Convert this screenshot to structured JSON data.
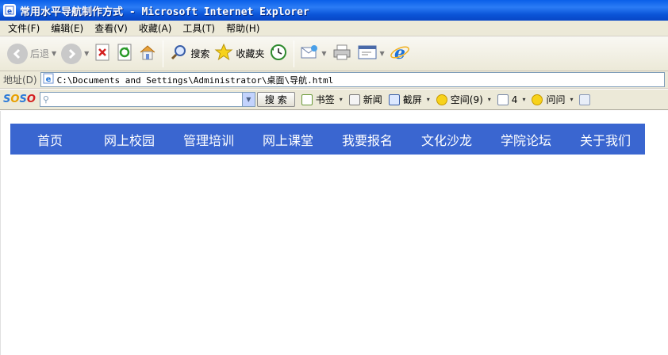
{
  "window": {
    "title": "常用水平导航制作方式 - Microsoft Internet Explorer"
  },
  "menu": [
    {
      "label": "文件(F)"
    },
    {
      "label": "编辑(E)"
    },
    {
      "label": "查看(V)"
    },
    {
      "label": "收藏(A)"
    },
    {
      "label": "工具(T)"
    },
    {
      "label": "帮助(H)"
    }
  ],
  "toolbar": {
    "back_label": "后退",
    "search_label": "搜索",
    "favorites_label": "收藏夹"
  },
  "address": {
    "label": "地址(D)",
    "url": "C:\\Documents and Settings\\Administrator\\桌面\\导航.html"
  },
  "soso": {
    "logo": "SOSO",
    "search_button": "搜 索",
    "bookmarks_label": "书签",
    "news_label": "新闻",
    "screenshot_label": "截屏",
    "space_label": "空间(9)",
    "mail_count": "4",
    "ask_label": "问问"
  },
  "nav": [
    {
      "label": "首页"
    },
    {
      "label": "网上校园"
    },
    {
      "label": "管理培训"
    },
    {
      "label": "网上课堂"
    },
    {
      "label": "我要报名"
    },
    {
      "label": "文化沙龙"
    },
    {
      "label": "学院论坛"
    },
    {
      "label": "关于我们"
    }
  ],
  "colors": {
    "nav_background": "#3a66d0",
    "nav_text": "#ffffff",
    "titlebar": "#0a5fe8"
  }
}
